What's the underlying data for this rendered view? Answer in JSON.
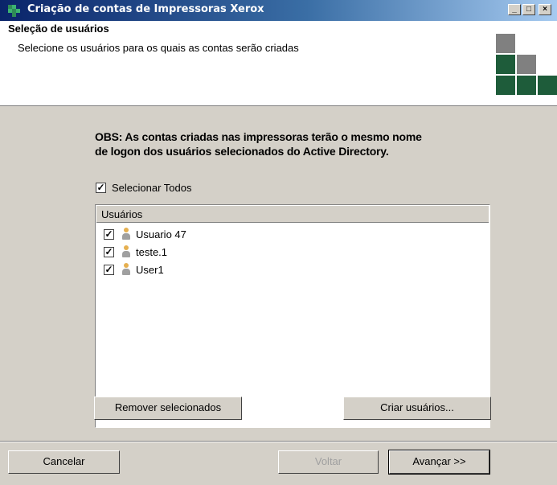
{
  "window": {
    "title": "Criação de contas de Impressoras Xerox",
    "minimize_label": "_",
    "maximize_label": "□",
    "close_label": "×"
  },
  "header": {
    "title": "Seleção de usuários",
    "subtitle": "Selecione os usuários para os quais as contas serão criadas"
  },
  "main": {
    "obs_line1": "OBS: As contas criadas nas impressoras terão o mesmo nome",
    "obs_line2": "de logon dos usuários selecionados do Active Directory.",
    "select_all_label": "Selecionar Todos",
    "select_all_checked": true,
    "list_header": "Usuários",
    "users": [
      {
        "name": "Usuario 47",
        "checked": true
      },
      {
        "name": "teste.1",
        "checked": true
      },
      {
        "name": "User1",
        "checked": true
      }
    ],
    "remove_button": "Remover selecionados",
    "create_button": "Criar usuários..."
  },
  "footer": {
    "cancel_button": "Cancelar",
    "back_button": "Voltar",
    "next_button": "Avançar >>"
  },
  "colors": {
    "titlebar_start": "#0a246a",
    "logo_gray": "#808080",
    "logo_green": "#1e5c3a",
    "user_icon": "#e6b050"
  },
  "icons": {
    "app": "xerox-app-icon",
    "user": "user-icon",
    "check": "checkmark"
  }
}
